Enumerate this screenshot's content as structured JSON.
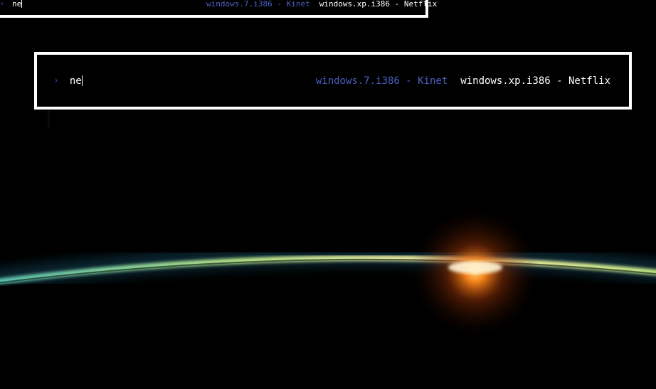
{
  "launcher": {
    "prompt_icon": "chevron-right-icon",
    "prompt_glyph": "›",
    "query": "ne",
    "results": [
      {
        "label": "windows.7.i386 - Kinet",
        "selected": false
      },
      {
        "label": "windows.xp.i386 - Netflix",
        "selected": true
      }
    ]
  },
  "colors": {
    "background": "#000000",
    "border": "#ffffff",
    "selected_text": "#ffffff",
    "unselected_text": "#4c5fc4",
    "horizon_glow": "#9fe0a0",
    "sunrise": "#ff8a1c"
  }
}
